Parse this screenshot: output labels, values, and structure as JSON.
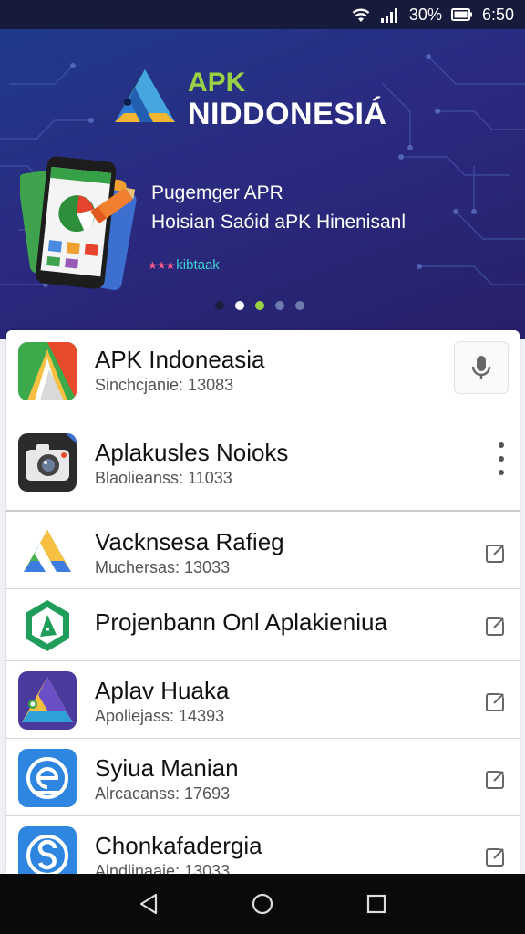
{
  "status_bar": {
    "battery_text": "30%",
    "time": "6:50"
  },
  "hero": {
    "logo_line1": "APK",
    "logo_line2": "NIDDONESIÁ",
    "line1": "Pugemger APR",
    "line2": "Hoisian Saóid aPK Hinenisanl",
    "tag_stars": "★★★",
    "tag": "kibtaak",
    "carousel": {
      "dot_count": 5,
      "active_index": 1
    }
  },
  "colors": {
    "accent_green": "#9bd245",
    "hero_bg": "#2a2a80",
    "tag_color": "#3fd0d0"
  },
  "apps": [
    {
      "title": "APK Indoneasia",
      "subtitle": "Sinchcjanie: 13083",
      "icon": "apk-indonesia-icon",
      "action": "mic-icon"
    },
    {
      "title": "Aplakusles Noioks",
      "subtitle": "Blaolieanss: 11033",
      "icon": "camera-app-icon",
      "action": "more-vert-icon"
    },
    {
      "title": "Vacknsesa Rafieg",
      "subtitle": "Muchersas: 13033",
      "icon": "drive-triangle-icon",
      "action": "edit-icon"
    },
    {
      "title": "Projenbann Onl Aplakieniua",
      "subtitle": "",
      "icon": "green-hexagon-icon",
      "action": "edit-icon"
    },
    {
      "title": "Aplav Huaka",
      "subtitle": "Apoliejass: 14393",
      "icon": "purple-triangle-icon",
      "action": "edit-icon"
    },
    {
      "title": "Syiua Manian",
      "subtitle": "Alrcacanss: 17693",
      "icon": "blue-e-icon",
      "action": "edit-icon"
    },
    {
      "title": "Chonkafadergia",
      "subtitle": "Alndlinaaie: 13033",
      "icon": "blue-s-icon",
      "action": "edit-icon"
    }
  ],
  "nav": {
    "back": "back-icon",
    "home": "home-icon",
    "recents": "recents-icon"
  }
}
